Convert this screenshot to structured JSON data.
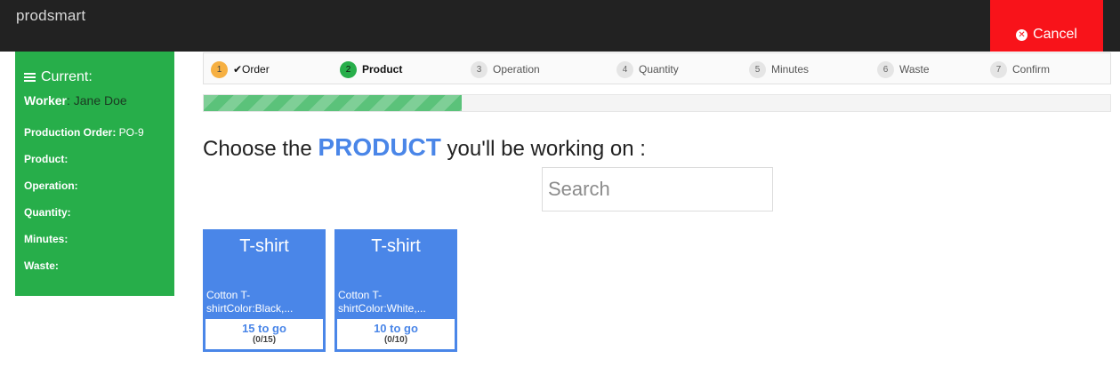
{
  "header": {
    "brand": "prodsmart",
    "cancel_label": "Cancel",
    "cancel_color": "#f8131a"
  },
  "sidebar": {
    "title": "Current:",
    "worker_label": "Worker",
    "worker_value": ": Jane Doe",
    "rows": [
      {
        "label": "Production Order:",
        "value": " PO-9"
      },
      {
        "label": "Product:",
        "value": ""
      },
      {
        "label": "Operation:",
        "value": ""
      },
      {
        "label": "Quantity:",
        "value": ""
      },
      {
        "label": "Minutes:",
        "value": ""
      },
      {
        "label": "Waste:",
        "value": ""
      }
    ],
    "color": "#27ae4a"
  },
  "steps": [
    {
      "num": "1",
      "label": "✔Order",
      "state": "done"
    },
    {
      "num": "2",
      "label": "Product",
      "state": "active"
    },
    {
      "num": "3",
      "label": "Operation",
      "state": "pending"
    },
    {
      "num": "4",
      "label": "Quantity",
      "state": "pending"
    },
    {
      "num": "5",
      "label": "Minutes",
      "state": "pending"
    },
    {
      "num": "6",
      "label": "Waste",
      "state": "pending"
    },
    {
      "num": "7",
      "label": "Confirm",
      "state": "pending"
    }
  ],
  "progress": {
    "fraction": 0.285
  },
  "main": {
    "heading_pre": "Choose the ",
    "heading_strong": "PRODUCT",
    "heading_post": " you'll be working on :",
    "search_placeholder": "Search"
  },
  "products": [
    {
      "title": "T-shirt",
      "desc_line1": "Cotton T-",
      "desc_line2": "shirtColor:Black,...",
      "to_go": "15 to go",
      "count": "(0/15)"
    },
    {
      "title": "T-shirt",
      "desc_line1": "Cotton T-",
      "desc_line2": "shirtColor:White,...",
      "to_go": "10 to go",
      "count": "(0/10)"
    }
  ],
  "colors": {
    "accent": "#4a86e8",
    "pending_step": "#f6b042"
  }
}
